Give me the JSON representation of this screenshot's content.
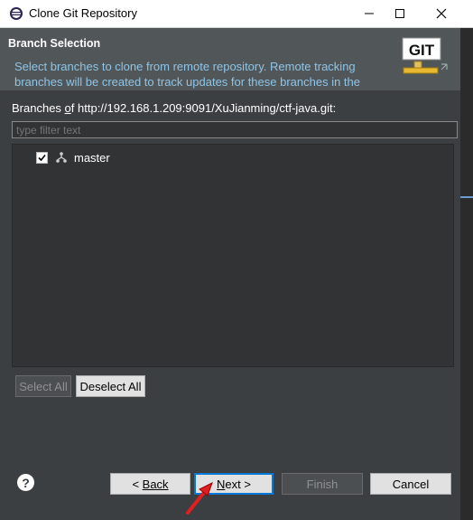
{
  "window": {
    "title": "Clone Git Repository"
  },
  "header": {
    "title": "Branch Selection",
    "description": "Select branches to clone from remote repository. Remote tracking branches will be created to track updates for these branches in the",
    "logo_text": "GIT"
  },
  "branches": {
    "label_prefix": "Branches ",
    "label_of": "o",
    "label_rest": "f http://192.168.1.209:9091/XuJianming/ctf-java.git:",
    "filter_placeholder": "type filter text",
    "items": [
      {
        "name": "master",
        "checked": true
      }
    ]
  },
  "buttons": {
    "select_all": "Select All",
    "deselect_all": "Deselect All",
    "back_rest": " Back",
    "back_prefix": "<",
    "next_mnemonic": "N",
    "next_rest": "ext >",
    "finish": "Finish",
    "cancel": "Cancel"
  },
  "colors": {
    "accent": "#0078d7",
    "description_text": "#8ec5e8",
    "arrow": "#e02020"
  }
}
